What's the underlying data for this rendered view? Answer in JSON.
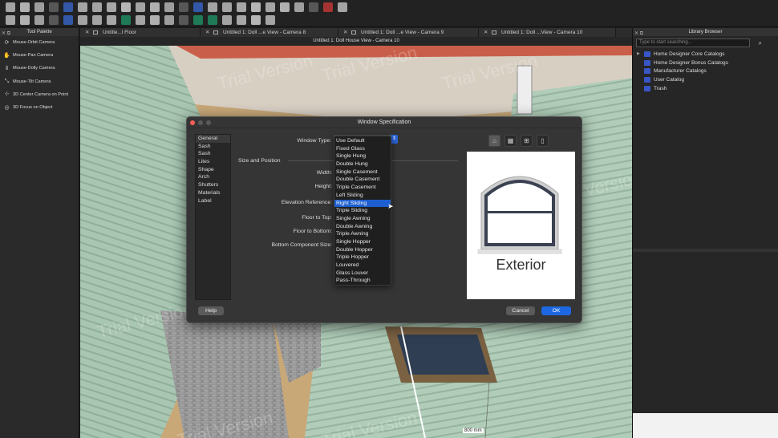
{
  "toolbar": {
    "icons_row1": [
      "file-new-icon",
      "open-icon",
      "save-icon",
      "print-icon",
      "undo-icon",
      "redo-icon",
      "camera-icon",
      "zoom-in-icon",
      "zoom-out-icon",
      "fit-icon",
      "fill-window-icon",
      "render-icon",
      "layer-icon",
      "select-icon",
      "arrow-up-icon",
      "dimension-icon",
      "window-tool-icon",
      "stairs-icon",
      "roof-icon",
      "house-icon",
      "text-icon",
      "pencil-icon",
      "delete-icon",
      "ruler-icon"
    ],
    "icons_row2": [
      "select-arrow-icon",
      "edit-icon",
      "plan-view-icon",
      "elevation-icon",
      "wall-icon",
      "layers-icon",
      "camera-view-icon",
      "section-icon",
      "cabinet-icon",
      "terrain-icon",
      "material-icon",
      "color-icon",
      "glasses-icon",
      "door-icon",
      "window-icon",
      "rotate-icon",
      "paint-icon",
      "brush-icon",
      "target-icon"
    ]
  },
  "palette": {
    "title": "Tool Palette",
    "items": [
      {
        "label": "Mouse-Orbit Camera",
        "icon": "orbit-icon"
      },
      {
        "label": "Mouse-Pan Camera",
        "icon": "hand-icon"
      },
      {
        "label": "Mouse-Dolly Camera",
        "icon": "dolly-icon"
      },
      {
        "label": "Mouse-Tilt Camera",
        "icon": "tilt-icon"
      },
      {
        "label": "3D Center Camera on Point",
        "icon": "center-icon"
      },
      {
        "label": "3D Focus on Object",
        "icon": "focus-icon"
      }
    ]
  },
  "tabs": [
    {
      "label": "Untitle...l Floor"
    },
    {
      "label": "Untitled 1: Doll ...e View - Camera 8"
    },
    {
      "label": "Untitled 1: Doll ...e View - Camera 9"
    },
    {
      "label": "Untitled 1: Doll ...View - Camera 10"
    }
  ],
  "view_title": "Untitled 1: Doll House View - Camera 10",
  "watermark": "Trial Version",
  "dimension_label": "800 mm",
  "library": {
    "title": "Library Browser",
    "search_placeholder": "Type to start searching...",
    "items": [
      {
        "label": "Home Designer Core Catalogs",
        "expandable": true
      },
      {
        "label": "Home Designer Bonus Catalogs",
        "expandable": false
      },
      {
        "label": "Manufacturer Catalogs",
        "expandable": false
      },
      {
        "label": "User Catalog",
        "expandable": false
      },
      {
        "label": "Trash",
        "expandable": false
      }
    ]
  },
  "dialog": {
    "title": "Window Specification",
    "categories": [
      "General",
      "Sash",
      "Sash",
      "Lites",
      "Shape",
      "Arch",
      "Shutters",
      "Materials",
      "Label"
    ],
    "window_type_label": "Window Type:",
    "size_position_label": "Size and Position",
    "fields": [
      "Width:",
      "Height:",
      "Elevation Reference:",
      "Floor to Top:",
      "Floor to Bottom:",
      "Bottom Component Size:"
    ],
    "window_types": [
      "Use Default",
      "Fixed Glass",
      "Single Hung",
      "Double Hung",
      "Single Casement",
      "Double Casement",
      "Triple Casement",
      "Left Sliding",
      "Right Sliding",
      "Triple Sliding",
      "Single Awning",
      "Double Awning",
      "Triple Awning",
      "Single Hopper",
      "Double Hopper",
      "Triple Hopper",
      "Louvered",
      "Glass Louver",
      "Pass-Through"
    ],
    "selected_window_type": "Right Sliding",
    "preview_label": "Exterior",
    "preview_icons": [
      "exterior-view-icon",
      "plan-view-icon",
      "interior-view-icon",
      "side-view-icon"
    ],
    "buttons": {
      "help": "Help",
      "cancel": "Cancel",
      "ok": "OK"
    }
  }
}
